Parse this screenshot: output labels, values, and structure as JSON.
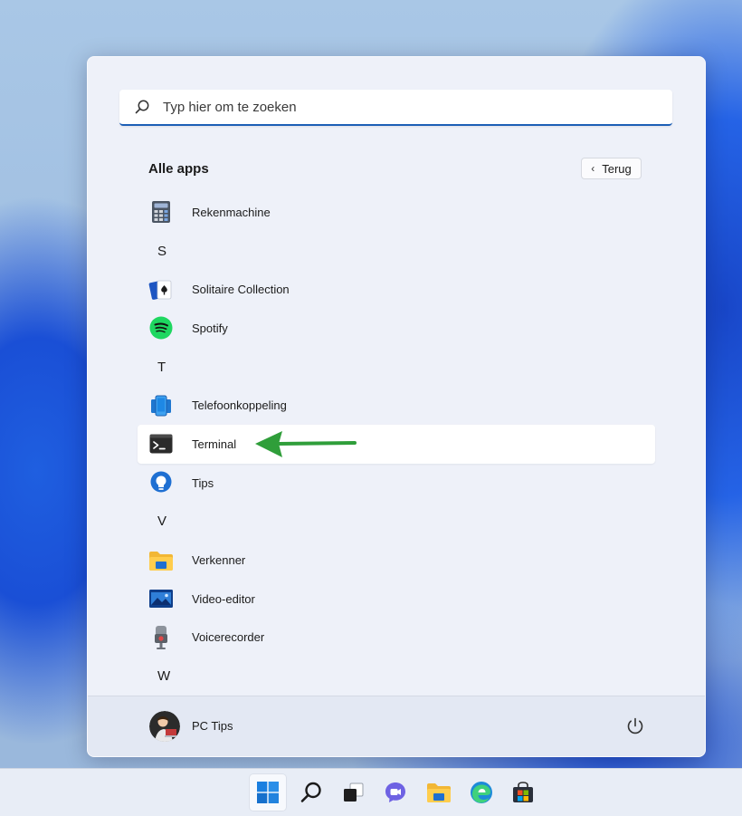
{
  "search": {
    "placeholder": "Typ hier om te zoeken"
  },
  "header": {
    "title": "Alle apps",
    "back_label": "Terug"
  },
  "list": [
    {
      "type": "app",
      "label": "Rekenmachine",
      "icon": "calculator-icon"
    },
    {
      "type": "letter",
      "label": "S"
    },
    {
      "type": "app",
      "label": "Solitaire Collection",
      "icon": "cards-icon"
    },
    {
      "type": "app",
      "label": "Spotify",
      "icon": "spotify-icon"
    },
    {
      "type": "letter",
      "label": "T"
    },
    {
      "type": "app",
      "label": "Telefoonkoppeling",
      "icon": "phone-link-icon"
    },
    {
      "type": "app",
      "label": "Terminal",
      "icon": "terminal-icon",
      "highlighted": true
    },
    {
      "type": "app",
      "label": "Tips",
      "icon": "tips-icon"
    },
    {
      "type": "letter",
      "label": "V"
    },
    {
      "type": "app",
      "label": "Verkenner",
      "icon": "folder-icon"
    },
    {
      "type": "app",
      "label": "Video-editor",
      "icon": "video-editor-icon"
    },
    {
      "type": "app",
      "label": "Voicerecorder",
      "icon": "microphone-icon"
    },
    {
      "type": "letter",
      "label": "W"
    }
  ],
  "footer": {
    "user_name": "PC Tips"
  },
  "taskbar": {
    "icons": [
      "windows-start-icon",
      "search-icon",
      "task-view-icon",
      "chat-icon",
      "file-explorer-icon",
      "edge-icon",
      "store-icon"
    ]
  },
  "colors": {
    "accent": "#1c5fb6",
    "arrow": "#2f9e3a"
  }
}
